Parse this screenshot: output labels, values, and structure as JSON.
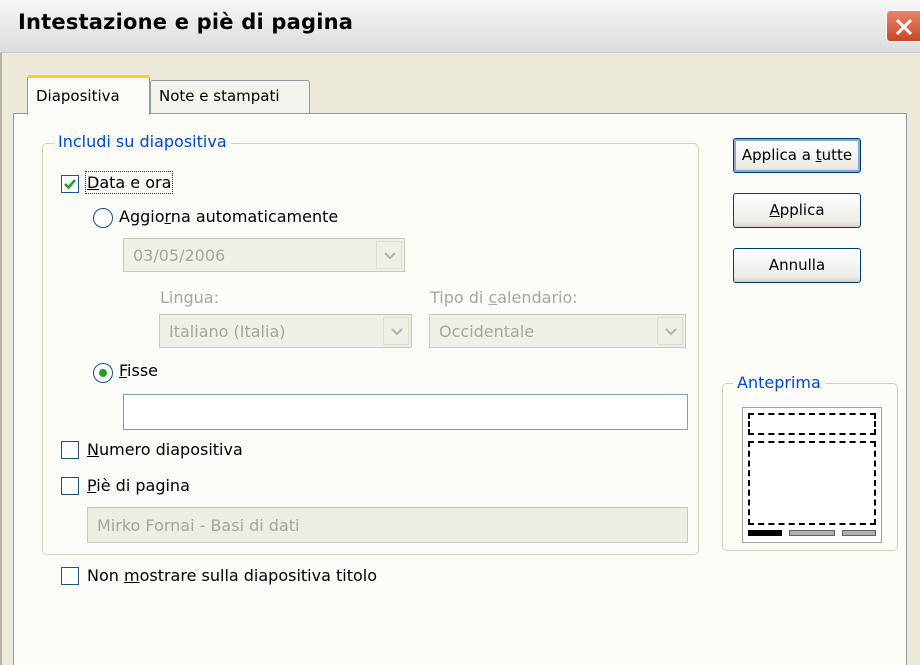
{
  "dialog": {
    "title": "Intestazione e piè di pagina",
    "close_icon": "close-icon"
  },
  "tabs": [
    {
      "label": "Diapositiva",
      "active": true
    },
    {
      "label": "Note e stampati",
      "active": false
    }
  ],
  "include_group": {
    "legend": "Includi su diapositiva",
    "date_time": {
      "prefix": "D",
      "rest": "ata e ora",
      "checked": true
    },
    "auto_update": {
      "pre": "Aggio",
      "key": "r",
      "post": "na automaticamente",
      "selected": false
    },
    "date_combo_value": "03/05/2006",
    "language": {
      "label": "Lingua:",
      "value": "Italiano (Italia)"
    },
    "calendar": {
      "label_pre": "Tipo di ",
      "label_key": "c",
      "label_post": "alendario:",
      "value": "Occidentale"
    },
    "fixed": {
      "key": "F",
      "rest": "isse",
      "selected": true,
      "value": ""
    },
    "slide_number": {
      "key": "N",
      "rest": "umero diapositiva",
      "checked": false
    },
    "footer": {
      "key": "P",
      "rest": "iè di pagina",
      "checked": false,
      "value": "Mirko Fornai - Basi di dati"
    }
  },
  "dont_show_title": {
    "pre": "Non ",
    "key": "m",
    "post": "ostrare sulla diapositiva titolo",
    "checked": false
  },
  "buttons": {
    "apply_all": {
      "pre": "Applica a ",
      "key": "t",
      "post": "utte"
    },
    "apply": {
      "key": "A",
      "post": "pplica"
    },
    "cancel": "Annulla"
  },
  "preview": {
    "legend": "Anteprima"
  },
  "colors": {
    "accent": "#0046d5",
    "check": "#21a121",
    "tab_highlight": "#ffc83c",
    "close": "#c8482b"
  }
}
